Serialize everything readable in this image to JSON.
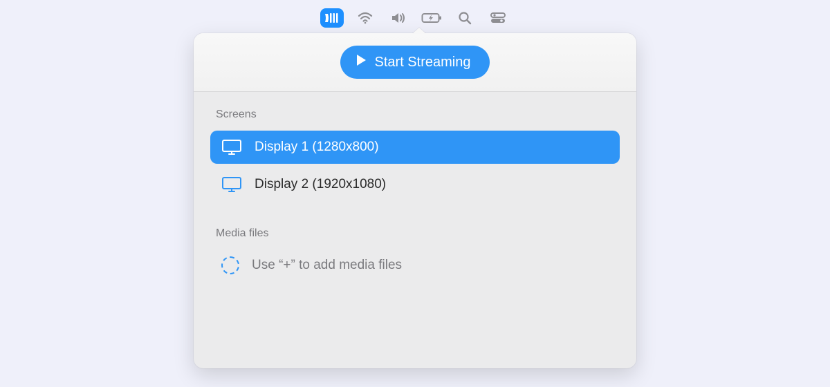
{
  "menubar": {
    "items": [
      {
        "name": "streaming-icon",
        "active": true
      },
      {
        "name": "wifi-icon",
        "active": false
      },
      {
        "name": "volume-icon",
        "active": false
      },
      {
        "name": "battery-charging-icon",
        "active": false
      },
      {
        "name": "search-icon",
        "active": false
      },
      {
        "name": "control-center-icon",
        "active": false
      }
    ]
  },
  "header": {
    "start_label": "Start Streaming"
  },
  "screens": {
    "section_label": "Screens",
    "items": [
      {
        "label": "Display 1 (1280x800)",
        "selected": true
      },
      {
        "label": "Display 2 (1920x1080)",
        "selected": false
      }
    ]
  },
  "media": {
    "section_label": "Media files",
    "placeholder": "Use “+” to add media files"
  }
}
